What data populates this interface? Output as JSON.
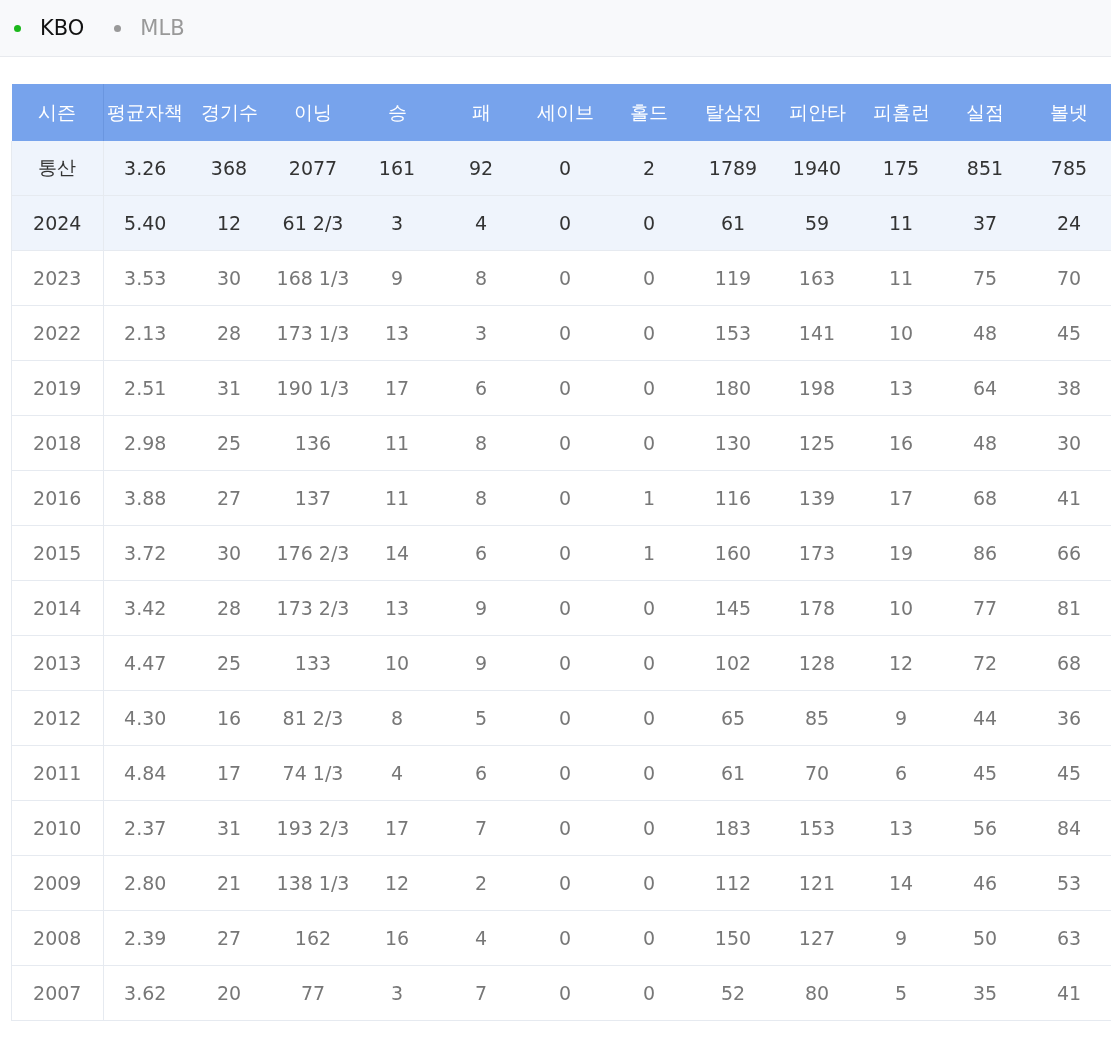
{
  "tabs": [
    {
      "label": "KBO",
      "selected": true
    },
    {
      "label": "MLB",
      "selected": false
    }
  ],
  "table": {
    "columns": [
      "시즌",
      "평균자책",
      "경기수",
      "이닝",
      "승",
      "패",
      "세이브",
      "홀드",
      "탈삼진",
      "피안타",
      "피홈런",
      "실점",
      "볼넷"
    ],
    "rows": [
      {
        "highlighted": true,
        "cells": [
          "통산",
          "3.26",
          "368",
          "2077",
          "161",
          "92",
          "0",
          "2",
          "1789",
          "1940",
          "175",
          "851",
          "785"
        ]
      },
      {
        "highlighted": true,
        "cells": [
          "2024",
          "5.40",
          "12",
          "61 2/3",
          "3",
          "4",
          "0",
          "0",
          "61",
          "59",
          "11",
          "37",
          "24"
        ]
      },
      {
        "highlighted": false,
        "cells": [
          "2023",
          "3.53",
          "30",
          "168 1/3",
          "9",
          "8",
          "0",
          "0",
          "119",
          "163",
          "11",
          "75",
          "70"
        ]
      },
      {
        "highlighted": false,
        "cells": [
          "2022",
          "2.13",
          "28",
          "173 1/3",
          "13",
          "3",
          "0",
          "0",
          "153",
          "141",
          "10",
          "48",
          "45"
        ]
      },
      {
        "highlighted": false,
        "cells": [
          "2019",
          "2.51",
          "31",
          "190 1/3",
          "17",
          "6",
          "0",
          "0",
          "180",
          "198",
          "13",
          "64",
          "38"
        ]
      },
      {
        "highlighted": false,
        "cells": [
          "2018",
          "2.98",
          "25",
          "136",
          "11",
          "8",
          "0",
          "0",
          "130",
          "125",
          "16",
          "48",
          "30"
        ]
      },
      {
        "highlighted": false,
        "cells": [
          "2016",
          "3.88",
          "27",
          "137",
          "11",
          "8",
          "0",
          "1",
          "116",
          "139",
          "17",
          "68",
          "41"
        ]
      },
      {
        "highlighted": false,
        "cells": [
          "2015",
          "3.72",
          "30",
          "176 2/3",
          "14",
          "6",
          "0",
          "1",
          "160",
          "173",
          "19",
          "86",
          "66"
        ]
      },
      {
        "highlighted": false,
        "cells": [
          "2014",
          "3.42",
          "28",
          "173 2/3",
          "13",
          "9",
          "0",
          "0",
          "145",
          "178",
          "10",
          "77",
          "81"
        ]
      },
      {
        "highlighted": false,
        "cells": [
          "2013",
          "4.47",
          "25",
          "133",
          "10",
          "9",
          "0",
          "0",
          "102",
          "128",
          "12",
          "72",
          "68"
        ]
      },
      {
        "highlighted": false,
        "cells": [
          "2012",
          "4.30",
          "16",
          "81 2/3",
          "8",
          "5",
          "0",
          "0",
          "65",
          "85",
          "9",
          "44",
          "36"
        ]
      },
      {
        "highlighted": false,
        "cells": [
          "2011",
          "4.84",
          "17",
          "74 1/3",
          "4",
          "6",
          "0",
          "0",
          "61",
          "70",
          "6",
          "45",
          "45"
        ]
      },
      {
        "highlighted": false,
        "cells": [
          "2010",
          "2.37",
          "31",
          "193 2/3",
          "17",
          "7",
          "0",
          "0",
          "183",
          "153",
          "13",
          "56",
          "84"
        ]
      },
      {
        "highlighted": false,
        "cells": [
          "2009",
          "2.80",
          "21",
          "138 1/3",
          "12",
          "2",
          "0",
          "0",
          "112",
          "121",
          "14",
          "46",
          "53"
        ]
      },
      {
        "highlighted": false,
        "cells": [
          "2008",
          "2.39",
          "27",
          "162",
          "16",
          "4",
          "0",
          "0",
          "150",
          "127",
          "9",
          "50",
          "63"
        ]
      },
      {
        "highlighted": false,
        "cells": [
          "2007",
          "3.62",
          "20",
          "77",
          "3",
          "7",
          "0",
          "0",
          "52",
          "80",
          "5",
          "35",
          "41"
        ]
      }
    ]
  }
}
